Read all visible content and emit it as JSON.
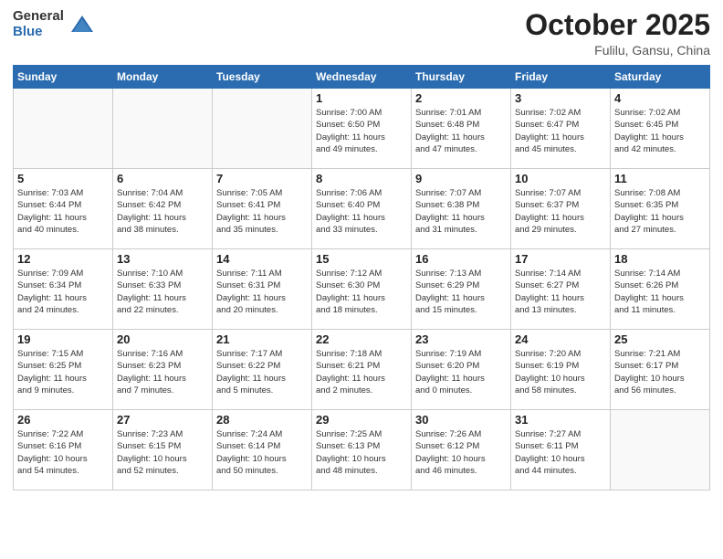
{
  "header": {
    "logo_general": "General",
    "logo_blue": "Blue",
    "month_title": "October 2025",
    "location": "Fulilu, Gansu, China"
  },
  "days_of_week": [
    "Sunday",
    "Monday",
    "Tuesday",
    "Wednesday",
    "Thursday",
    "Friday",
    "Saturday"
  ],
  "weeks": [
    [
      {
        "day": "",
        "info": ""
      },
      {
        "day": "",
        "info": ""
      },
      {
        "day": "",
        "info": ""
      },
      {
        "day": "1",
        "info": "Sunrise: 7:00 AM\nSunset: 6:50 PM\nDaylight: 11 hours\nand 49 minutes."
      },
      {
        "day": "2",
        "info": "Sunrise: 7:01 AM\nSunset: 6:48 PM\nDaylight: 11 hours\nand 47 minutes."
      },
      {
        "day": "3",
        "info": "Sunrise: 7:02 AM\nSunset: 6:47 PM\nDaylight: 11 hours\nand 45 minutes."
      },
      {
        "day": "4",
        "info": "Sunrise: 7:02 AM\nSunset: 6:45 PM\nDaylight: 11 hours\nand 42 minutes."
      }
    ],
    [
      {
        "day": "5",
        "info": "Sunrise: 7:03 AM\nSunset: 6:44 PM\nDaylight: 11 hours\nand 40 minutes."
      },
      {
        "day": "6",
        "info": "Sunrise: 7:04 AM\nSunset: 6:42 PM\nDaylight: 11 hours\nand 38 minutes."
      },
      {
        "day": "7",
        "info": "Sunrise: 7:05 AM\nSunset: 6:41 PM\nDaylight: 11 hours\nand 35 minutes."
      },
      {
        "day": "8",
        "info": "Sunrise: 7:06 AM\nSunset: 6:40 PM\nDaylight: 11 hours\nand 33 minutes."
      },
      {
        "day": "9",
        "info": "Sunrise: 7:07 AM\nSunset: 6:38 PM\nDaylight: 11 hours\nand 31 minutes."
      },
      {
        "day": "10",
        "info": "Sunrise: 7:07 AM\nSunset: 6:37 PM\nDaylight: 11 hours\nand 29 minutes."
      },
      {
        "day": "11",
        "info": "Sunrise: 7:08 AM\nSunset: 6:35 PM\nDaylight: 11 hours\nand 27 minutes."
      }
    ],
    [
      {
        "day": "12",
        "info": "Sunrise: 7:09 AM\nSunset: 6:34 PM\nDaylight: 11 hours\nand 24 minutes."
      },
      {
        "day": "13",
        "info": "Sunrise: 7:10 AM\nSunset: 6:33 PM\nDaylight: 11 hours\nand 22 minutes."
      },
      {
        "day": "14",
        "info": "Sunrise: 7:11 AM\nSunset: 6:31 PM\nDaylight: 11 hours\nand 20 minutes."
      },
      {
        "day": "15",
        "info": "Sunrise: 7:12 AM\nSunset: 6:30 PM\nDaylight: 11 hours\nand 18 minutes."
      },
      {
        "day": "16",
        "info": "Sunrise: 7:13 AM\nSunset: 6:29 PM\nDaylight: 11 hours\nand 15 minutes."
      },
      {
        "day": "17",
        "info": "Sunrise: 7:14 AM\nSunset: 6:27 PM\nDaylight: 11 hours\nand 13 minutes."
      },
      {
        "day": "18",
        "info": "Sunrise: 7:14 AM\nSunset: 6:26 PM\nDaylight: 11 hours\nand 11 minutes."
      }
    ],
    [
      {
        "day": "19",
        "info": "Sunrise: 7:15 AM\nSunset: 6:25 PM\nDaylight: 11 hours\nand 9 minutes."
      },
      {
        "day": "20",
        "info": "Sunrise: 7:16 AM\nSunset: 6:23 PM\nDaylight: 11 hours\nand 7 minutes."
      },
      {
        "day": "21",
        "info": "Sunrise: 7:17 AM\nSunset: 6:22 PM\nDaylight: 11 hours\nand 5 minutes."
      },
      {
        "day": "22",
        "info": "Sunrise: 7:18 AM\nSunset: 6:21 PM\nDaylight: 11 hours\nand 2 minutes."
      },
      {
        "day": "23",
        "info": "Sunrise: 7:19 AM\nSunset: 6:20 PM\nDaylight: 11 hours\nand 0 minutes."
      },
      {
        "day": "24",
        "info": "Sunrise: 7:20 AM\nSunset: 6:19 PM\nDaylight: 10 hours\nand 58 minutes."
      },
      {
        "day": "25",
        "info": "Sunrise: 7:21 AM\nSunset: 6:17 PM\nDaylight: 10 hours\nand 56 minutes."
      }
    ],
    [
      {
        "day": "26",
        "info": "Sunrise: 7:22 AM\nSunset: 6:16 PM\nDaylight: 10 hours\nand 54 minutes."
      },
      {
        "day": "27",
        "info": "Sunrise: 7:23 AM\nSunset: 6:15 PM\nDaylight: 10 hours\nand 52 minutes."
      },
      {
        "day": "28",
        "info": "Sunrise: 7:24 AM\nSunset: 6:14 PM\nDaylight: 10 hours\nand 50 minutes."
      },
      {
        "day": "29",
        "info": "Sunrise: 7:25 AM\nSunset: 6:13 PM\nDaylight: 10 hours\nand 48 minutes."
      },
      {
        "day": "30",
        "info": "Sunrise: 7:26 AM\nSunset: 6:12 PM\nDaylight: 10 hours\nand 46 minutes."
      },
      {
        "day": "31",
        "info": "Sunrise: 7:27 AM\nSunset: 6:11 PM\nDaylight: 10 hours\nand 44 minutes."
      },
      {
        "day": "",
        "info": ""
      }
    ]
  ]
}
